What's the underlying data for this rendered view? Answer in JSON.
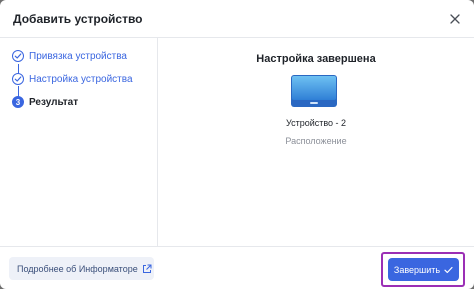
{
  "dialog": {
    "title": "Добавить устройство",
    "close_icon": "close-icon"
  },
  "steps": [
    {
      "label": "Привязка устройства",
      "state": "completed",
      "icon": "check-icon"
    },
    {
      "label": "Настройка устройства",
      "state": "completed",
      "icon": "check-icon"
    },
    {
      "label": "Результат",
      "state": "active",
      "number": "3"
    }
  ],
  "result": {
    "title": "Настройка завершена",
    "device_icon": "device-icon",
    "device_name": "Устройство - 2",
    "location": "Расположение"
  },
  "footer": {
    "info_label": "Подробнее об Информаторе",
    "info_icon": "external-link-icon",
    "finish_label": "Завершить",
    "finish_icon": "check-icon"
  },
  "colors": {
    "accent": "#3a66e0",
    "highlight_frame": "#9b2fb5"
  }
}
